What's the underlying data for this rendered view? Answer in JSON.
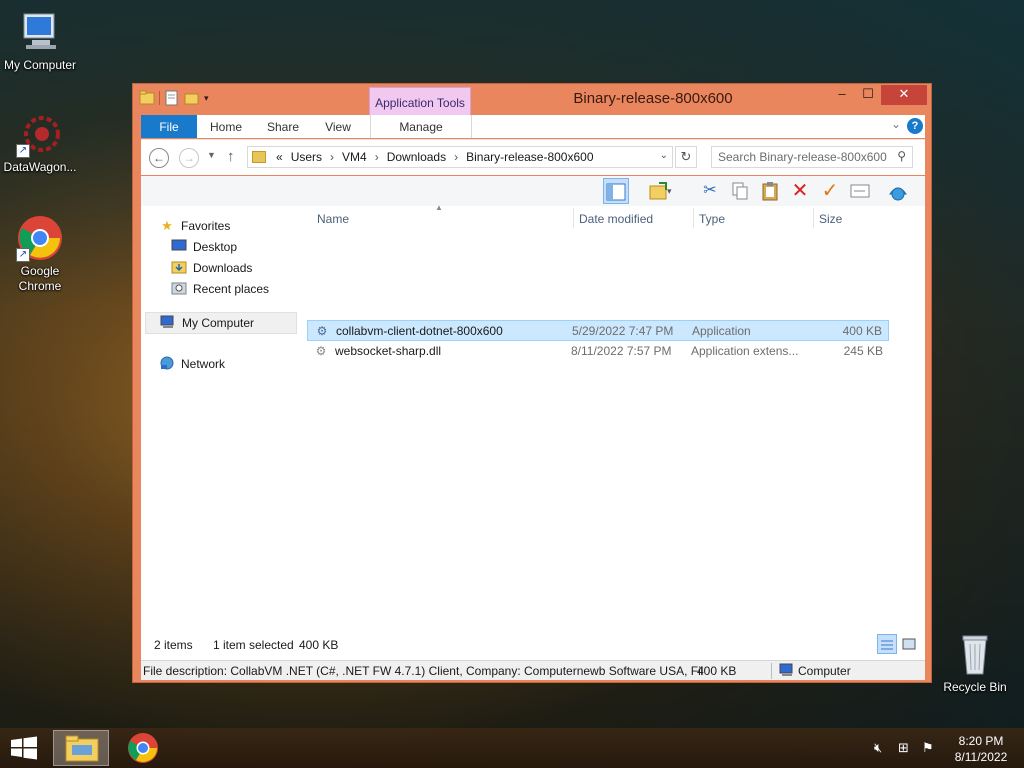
{
  "desktop": {
    "icons": [
      {
        "label": "My Computer",
        "icon": "computer-icon"
      },
      {
        "label": "DataWagon...",
        "icon": "datawagon-icon"
      },
      {
        "label": "Google Chrome",
        "icon": "chrome-icon"
      },
      {
        "label": "Recycle Bin",
        "icon": "recycle-bin-icon"
      }
    ]
  },
  "window": {
    "title": "Binary-release-800x600",
    "context_tab_group": "Application Tools",
    "ribbon_tabs": {
      "file": "File",
      "home": "Home",
      "share": "Share",
      "view": "View",
      "manage": "Manage"
    },
    "address": {
      "overflow": "«",
      "crumbs": [
        "Users",
        "VM4",
        "Downloads",
        "Binary-release-800x600"
      ]
    },
    "search": {
      "placeholder": "Search Binary-release-800x600"
    },
    "nav_pane": {
      "favorites": "Favorites",
      "desktop": "Desktop",
      "downloads": "Downloads",
      "recent": "Recent places",
      "my_computer": "My Computer",
      "network": "Network"
    },
    "columns": {
      "name": "Name",
      "date": "Date modified",
      "type": "Type",
      "size": "Size"
    },
    "files": [
      {
        "name": "collabvm-client-dotnet-800x600",
        "date": "5/29/2022 7:47 PM",
        "type": "Application",
        "size": "400 KB",
        "selected": true
      },
      {
        "name": "websocket-sharp.dll",
        "date": "8/11/2022 7:57 PM",
        "type": "Application extens...",
        "size": "245 KB",
        "selected": false
      }
    ],
    "status": {
      "items": "2 items",
      "selected": "1 item selected",
      "size": "400 KB"
    },
    "details": {
      "description": "File description: CollabVM .NET (C#, .NET FW 4.7.1) Client, Company: Computernewb Software USA, Fil",
      "size": "400 KB",
      "location": "Computer"
    }
  },
  "taskbar": {
    "time": "8:20 PM",
    "date": "8/11/2022"
  },
  "colors": {
    "window_frame": "#e9865e",
    "file_tab": "#1979ca",
    "context_tab": "#f0c8f0",
    "selection": "#cce8ff",
    "close_button": "#c7443a"
  }
}
